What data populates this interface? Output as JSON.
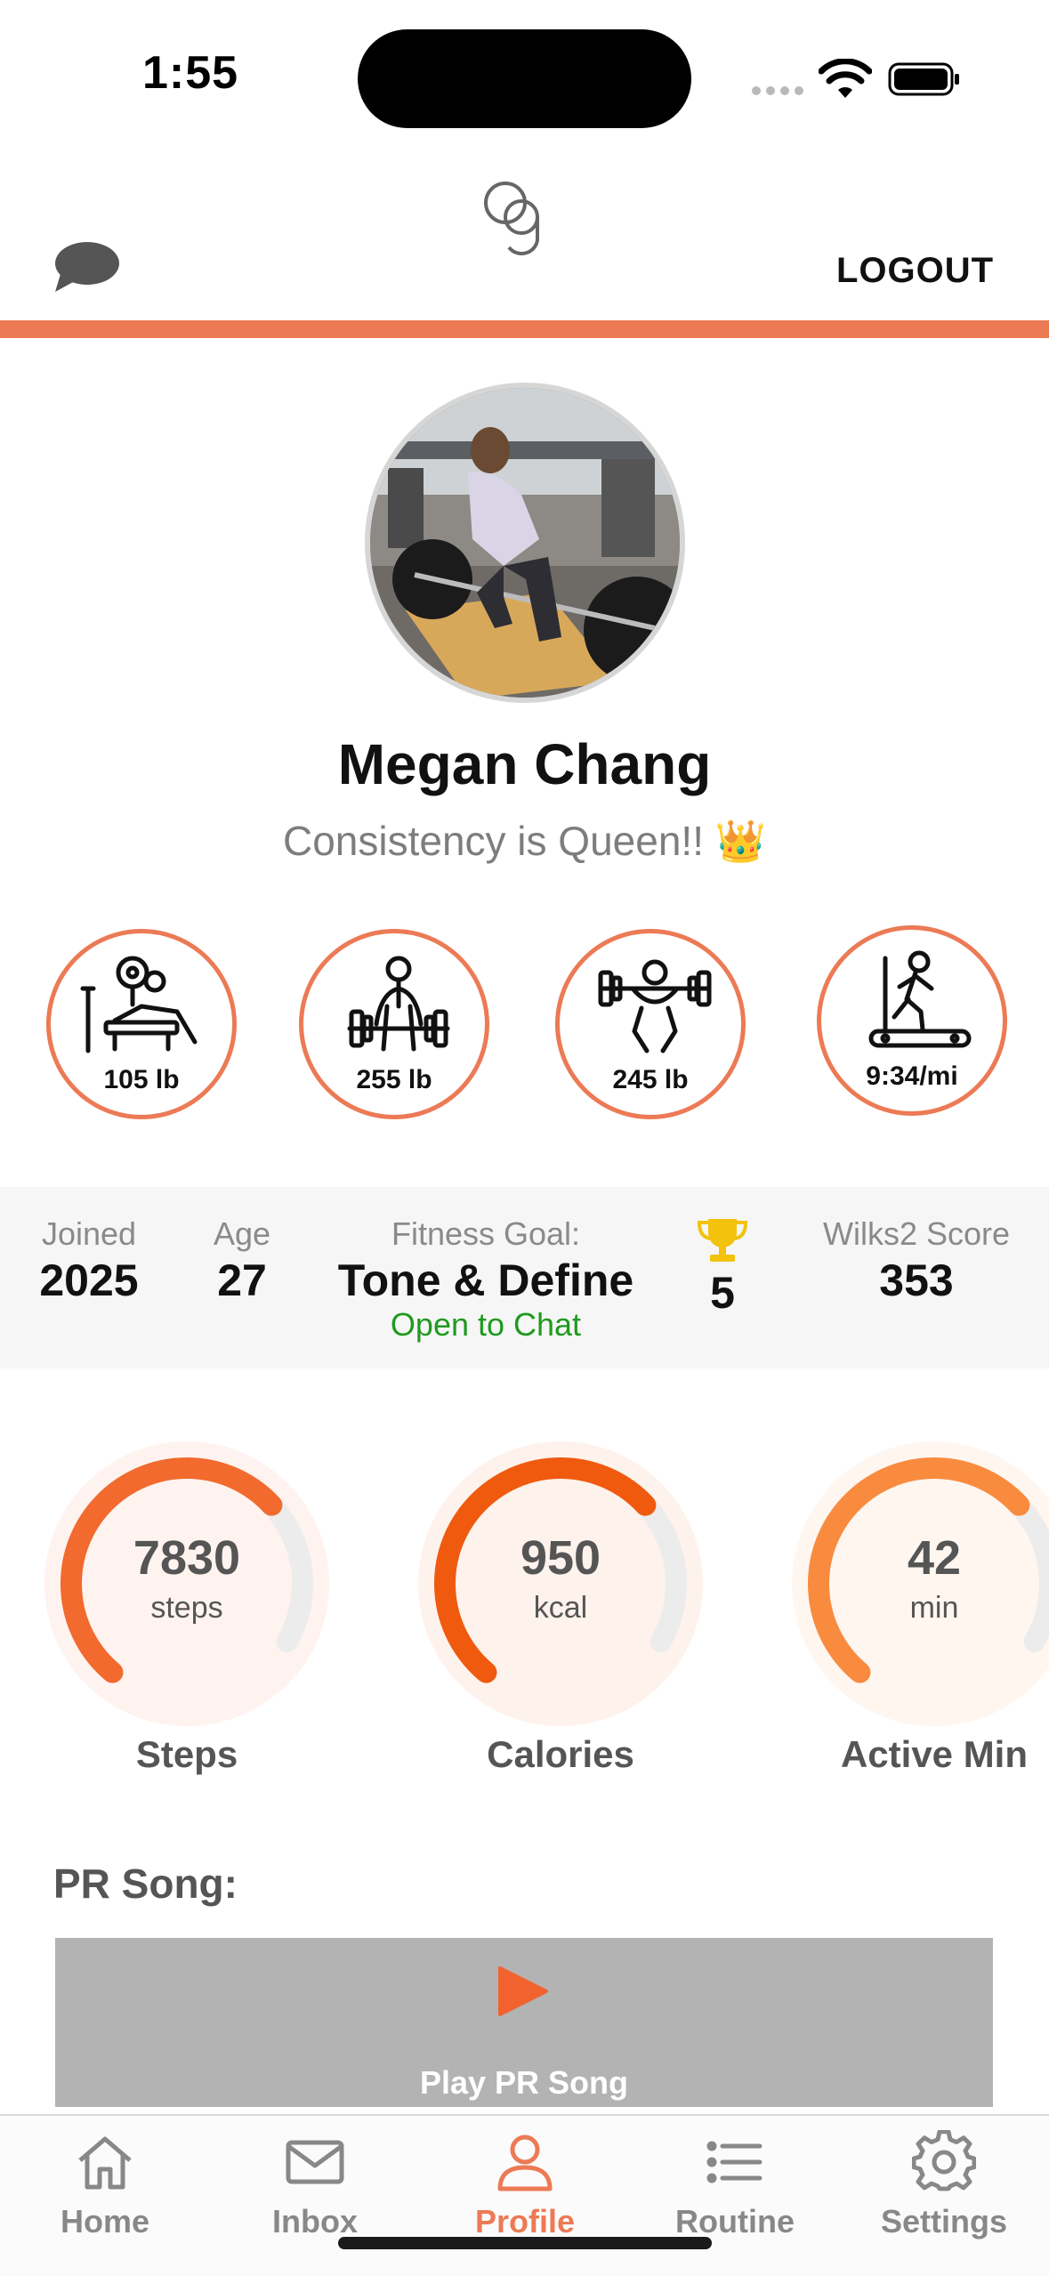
{
  "status_bar": {
    "time": "1:55"
  },
  "header": {
    "logout_label": "LOGOUT"
  },
  "profile": {
    "name": "Megan Chang",
    "tagline": "Consistency is Queen!! 👑"
  },
  "prs": [
    {
      "icon": "bench-press-icon",
      "value": "105 lb"
    },
    {
      "icon": "deadlift-icon",
      "value": "255 lb"
    },
    {
      "icon": "squat-icon",
      "value": "245 lb"
    },
    {
      "icon": "treadmill-icon",
      "value": "9:34/mi"
    }
  ],
  "stats": {
    "joined_label": "Joined",
    "joined_value": "2025",
    "age_label": "Age",
    "age_value": "27",
    "goal_label": "Fitness Goal:",
    "goal_value": "Tone & Define",
    "chat_status": "Open to Chat",
    "trophy_count": "5",
    "wilks_label": "Wilks2 Score",
    "wilks_value": "353"
  },
  "gauges": [
    {
      "value": "7830",
      "unit": "steps",
      "label": "Steps",
      "fill": 0.72,
      "color": "#f26a2e"
    },
    {
      "value": "950",
      "unit": "kcal",
      "label": "Calories",
      "fill": 0.72,
      "color": "#f05a0e"
    },
    {
      "value": "42",
      "unit": "min",
      "label": "Active Min",
      "fill": 0.72,
      "color": "#f98b3f"
    }
  ],
  "pr_song": {
    "title": "PR Song:",
    "play_label": "Play PR Song"
  },
  "tabs": [
    {
      "label": "Home",
      "icon": "home-icon",
      "active": false
    },
    {
      "label": "Inbox",
      "icon": "inbox-icon",
      "active": false
    },
    {
      "label": "Profile",
      "icon": "profile-icon",
      "active": true
    },
    {
      "label": "Routine",
      "icon": "routine-icon",
      "active": false
    },
    {
      "label": "Settings",
      "icon": "settings-icon",
      "active": false
    }
  ],
  "colors": {
    "accent": "#ec7a55",
    "chat_green": "#1f9a1f"
  }
}
